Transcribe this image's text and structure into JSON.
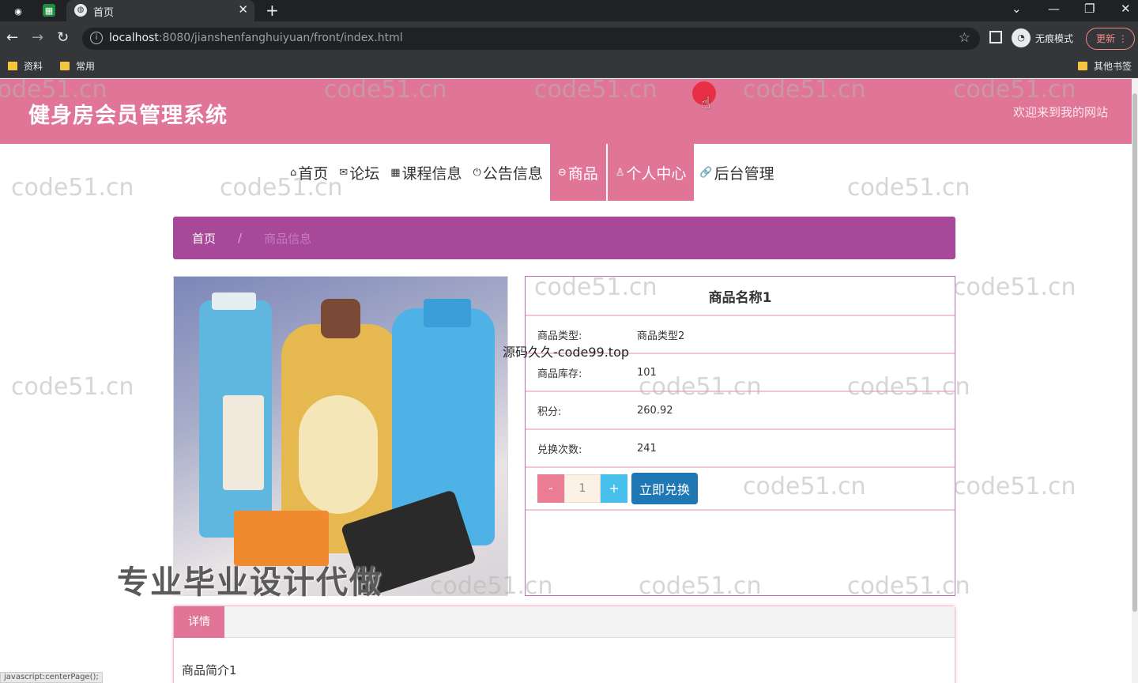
{
  "browser": {
    "tab_title": "首页",
    "url_host": "localhost",
    "url_rest": ":8080/jianshenfanghuiyuan/front/index.html",
    "profile_label": "无痕模式",
    "update_label": "更新",
    "bookmarks": [
      "资料",
      "常用"
    ],
    "other_bookmarks": "其他书签"
  },
  "header": {
    "title": "健身房会员管理系统",
    "welcome": "欢迎来到我的网站"
  },
  "nav": [
    {
      "icon": "⌂",
      "label": "首页"
    },
    {
      "icon": "✉",
      "label": "论坛"
    },
    {
      "icon": "▦",
      "label": "课程信息"
    },
    {
      "icon": "⏻",
      "label": "公告信息"
    },
    {
      "icon": "⊖",
      "label": "商品"
    },
    {
      "icon": "♙",
      "label": "个人中心"
    },
    {
      "icon": "🔗",
      "label": "后台管理"
    }
  ],
  "breadcrumb": {
    "home": "首页",
    "separator": "/",
    "current": "商品信息"
  },
  "product": {
    "name": "商品名称1",
    "rows": [
      {
        "label": "商品类型:",
        "value": "商品类型2"
      },
      {
        "label": "商品库存:",
        "value": "101"
      },
      {
        "label": "积分:",
        "value": "260.92"
      },
      {
        "label": "兑换次数:",
        "value": "241"
      }
    ],
    "quantity": "1",
    "minus_label": "-",
    "plus_label": "+",
    "buy_label": "立即兑换"
  },
  "detail": {
    "tab_label": "详情",
    "body": "商品简介1"
  },
  "watermarks": {
    "site": "code51.cn",
    "source": "源码久久-code99.top",
    "promo": "专业毕业设计代做"
  },
  "status_text": "javascript:centerPage();",
  "colors": {
    "header_pink": "#e07597",
    "breadcrumb_purple": "#a84899",
    "buy_blue": "#1f78b4"
  }
}
